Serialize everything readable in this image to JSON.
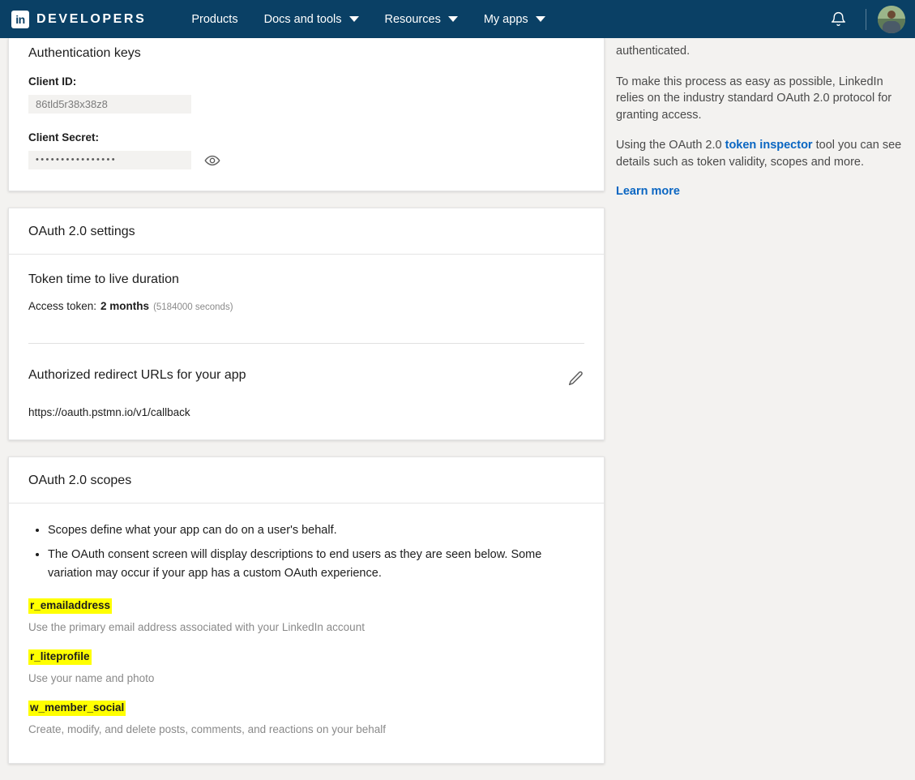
{
  "nav": {
    "logo_icon": "linkedin-logo-icon",
    "logo_text": "in",
    "brand": "DEVELOPERS",
    "items": [
      {
        "label": "Products",
        "has_caret": false
      },
      {
        "label": "Docs and tools",
        "has_caret": true
      },
      {
        "label": "Resources",
        "has_caret": true
      },
      {
        "label": "My apps",
        "has_caret": true
      }
    ],
    "bell_icon": "notifications-bell-icon",
    "avatar_icon": "user-avatar",
    "brand_color": "#0a4065"
  },
  "auth_keys": {
    "title": "Authentication keys",
    "client_id_label": "Client ID:",
    "client_id_value": "86tld5r38x38z8",
    "client_secret_label": "Client Secret:",
    "client_secret_value": "••••••••••••••••",
    "reveal_icon": "eye-icon"
  },
  "oauth_settings": {
    "card_title": "OAuth 2.0 settings",
    "ttl_title": "Token time to live duration",
    "access_token_label": "Access token:",
    "access_token_value": "2 months",
    "access_token_seconds": "(5184000 seconds)",
    "redirect_title": "Authorized redirect URLs for your app",
    "redirect_url": "https://oauth.pstmn.io/v1/callback",
    "edit_icon": "pencil-edit-icon"
  },
  "oauth_scopes": {
    "card_title": "OAuth 2.0 scopes",
    "bullets": [
      "Scopes define what your app can do on a user's behalf.",
      "The OAuth consent screen will display descriptions to end users as they are seen below. Some variation may occur if your app has a custom OAuth experience."
    ],
    "highlight_color": "#ffff00",
    "scopes": [
      {
        "name": "r_emailaddress",
        "description": "Use the primary email address associated with your LinkedIn account"
      },
      {
        "name": "r_liteprofile",
        "description": "Use your name and photo"
      },
      {
        "name": "w_member_social",
        "description": "Create, modify, and delete posts, comments, and reactions on your behalf"
      }
    ]
  },
  "side_panel": {
    "p1": "authenticated.",
    "p2": "To make this process as easy as possible, LinkedIn relies on the industry standard OAuth 2.0 protocol for granting access.",
    "p3_before": "Using the OAuth 2.0 ",
    "p3_link": "token inspector",
    "p3_after": " tool you can see details such as token validity, scopes and more.",
    "learn_more": "Learn more",
    "link_color": "#0a66c2"
  }
}
